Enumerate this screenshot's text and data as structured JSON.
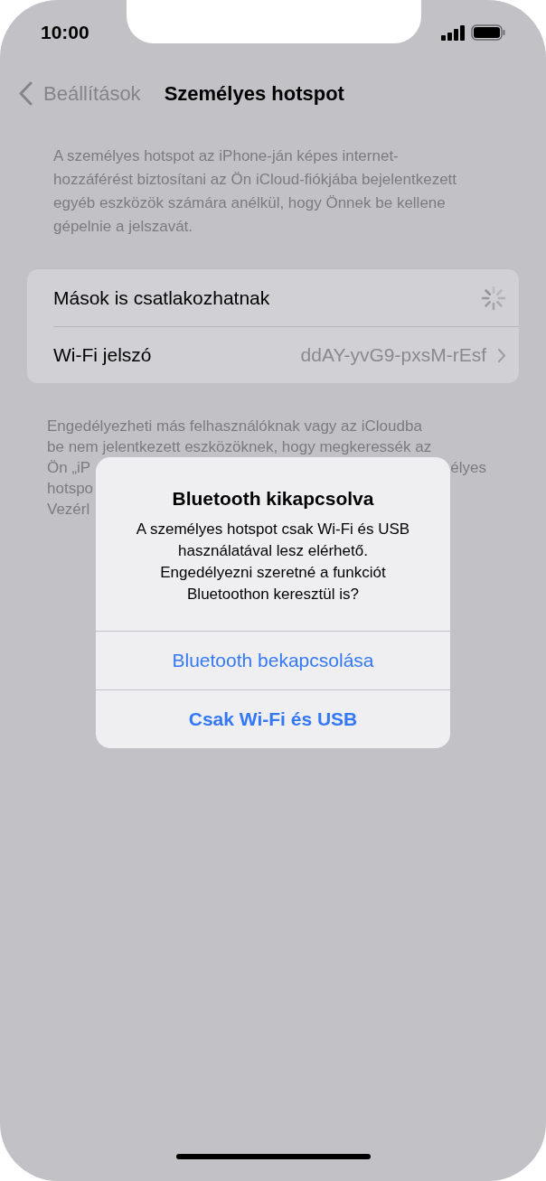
{
  "status_bar": {
    "time": "10:00"
  },
  "nav": {
    "back_label": "Beállítások",
    "title": "Személyes hotspot"
  },
  "description": "A személyes hotspot az iPhone-ján képes internet-hozzáférést biztosítani az Ön iCloud-fiókjába bejelentkezett egyéb eszközök számára anélkül, hogy Önnek be kellene gépelnie a jelszavát.",
  "settings": [
    {
      "kind": "spinner",
      "label": "Mások is csatlakozhatnak"
    },
    {
      "kind": "link",
      "label": "Wi-Fi jelszó",
      "value": "ddAY-yvG9-pxsM-rEsf"
    }
  ],
  "footer_lines": [
    {
      "left": "Engedélyezheti más felhasználóknak vagy az iCloudba"
    },
    {
      "left": "be nem jelentkezett eszközöknek, hogy megkeressék az"
    },
    {
      "left": "Ön „iP",
      "right": "élyes"
    },
    {
      "left": "hotspo"
    },
    {
      "left": "Vezérl"
    }
  ],
  "alert": {
    "title": "Bluetooth kikapcsolva",
    "message": "A személyes hotspot csak Wi-Fi és USB használatával lesz elérhető. Engedélyezni szeretné a funkciót Bluetoothon keresztül is?",
    "actions": [
      {
        "label": "Bluetooth bekapcsolása",
        "preferred": false
      },
      {
        "label": "Csak Wi-Fi és USB",
        "preferred": true
      }
    ]
  }
}
